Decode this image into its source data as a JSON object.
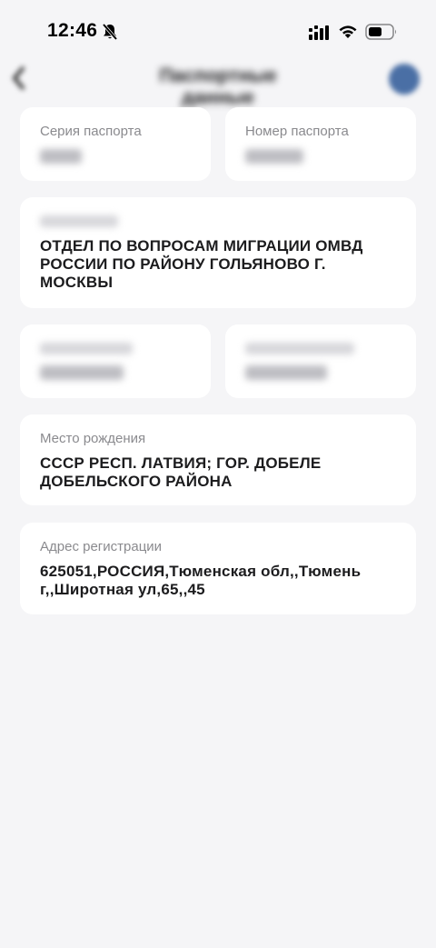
{
  "status_bar": {
    "time": "12:46"
  },
  "nav": {
    "title": "Паспортные данные"
  },
  "cards": {
    "series": {
      "label": "Серия паспорта"
    },
    "number": {
      "label": "Номер паспорта"
    },
    "issued_by": {
      "value": "ОТДЕЛ ПО ВОПРОСАМ МИГРАЦИИ ОМВД РОССИИ ПО РАЙОНУ ГОЛЬЯНОВО Г. МОСКВЫ"
    },
    "birth_place": {
      "label": "Место рождения",
      "value": "СССР РЕСП. ЛАТВИЯ; ГОР. ДОБЕЛЕ ДОБЕЛЬСКОГО РАЙОНА"
    },
    "reg_address": {
      "label": "Адрес регистрации",
      "value": "625051,РОССИЯ,Тюменская обл,,Тюмень г,,Широтная ул,65,,45"
    }
  },
  "colors": {
    "background": "#f5f5f7",
    "card": "#ffffff",
    "label": "#8a8a8e",
    "text": "#1c1c1e",
    "avatar": "#4a6fa5"
  },
  "icons": {
    "bell": "bell-slash-icon",
    "signal": "cellular-signal-icon",
    "wifi": "wifi-icon",
    "battery": "battery-icon",
    "back": "chevron-left-icon"
  }
}
